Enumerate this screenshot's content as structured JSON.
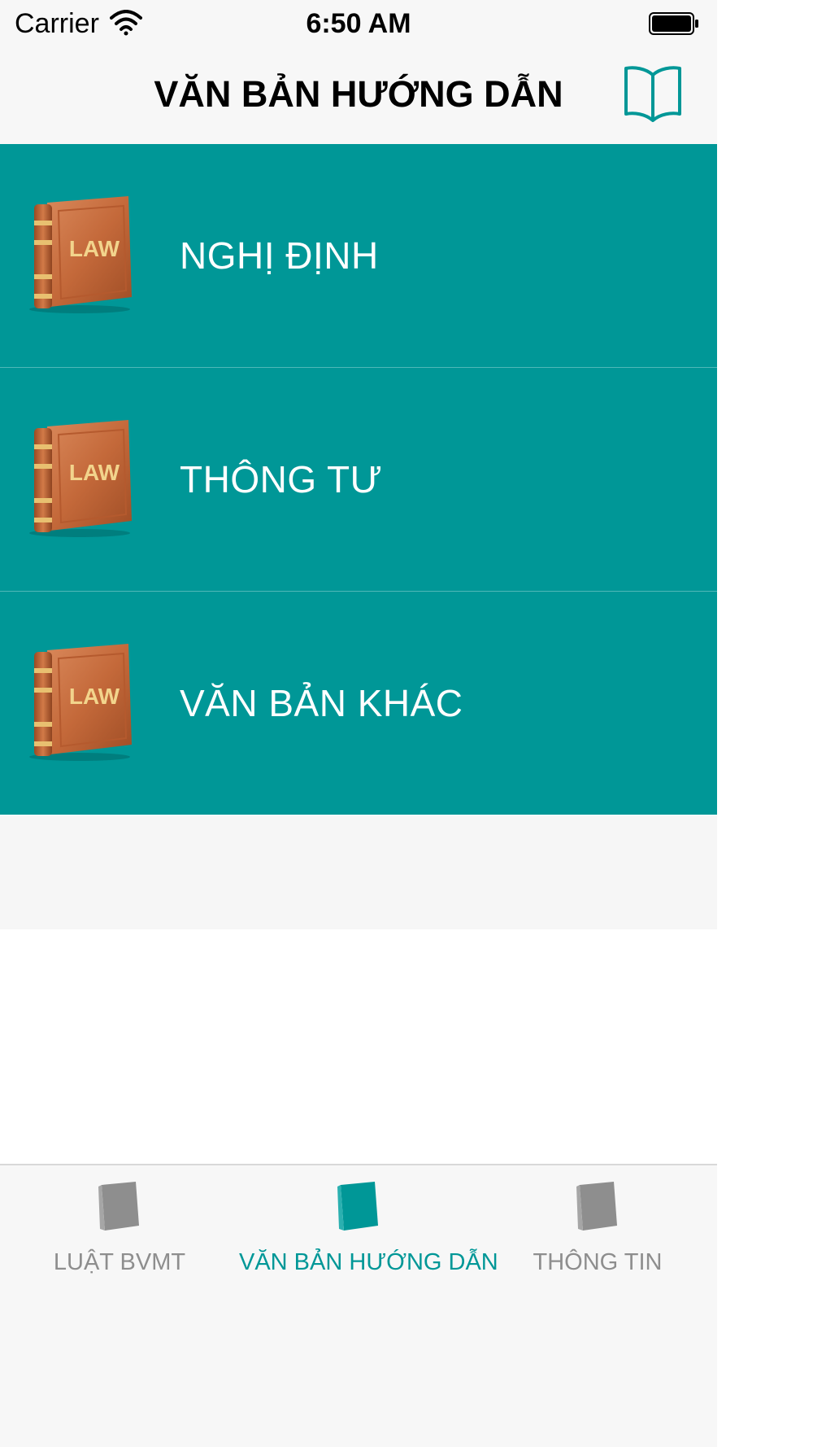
{
  "status_bar": {
    "carrier": "Carrier",
    "time": "6:50 AM"
  },
  "nav": {
    "title": "VĂN BẢN HƯỚNG DẪN",
    "right_icon": "book-open-icon"
  },
  "colors": {
    "accent": "#009797",
    "row_divider": "#4fb8b8",
    "bar_bg": "#f7f7f7",
    "tab_inactive": "#8e8e8e"
  },
  "menu": {
    "items": [
      {
        "label": "NGHỊ ĐỊNH",
        "icon": "law-book-icon",
        "icon_text": "LAW"
      },
      {
        "label": "THÔNG TƯ",
        "icon": "law-book-icon",
        "icon_text": "LAW"
      },
      {
        "label": "VĂN BẢN KHÁC",
        "icon": "law-book-icon",
        "icon_text": "LAW"
      }
    ]
  },
  "tabbar": {
    "tabs": [
      {
        "label": "LUẬT BVMT",
        "icon": "book-icon",
        "active": false
      },
      {
        "label": "VĂN BẢN HƯỚNG DẪN",
        "icon": "book-icon",
        "active": true
      },
      {
        "label": "THÔNG TIN",
        "icon": "book-icon",
        "active": false
      }
    ]
  }
}
